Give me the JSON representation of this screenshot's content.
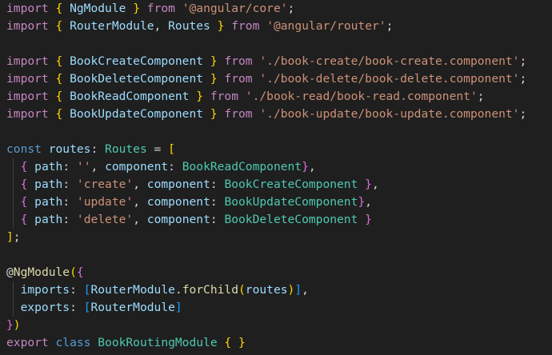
{
  "editor": {
    "background": "#1f1f1f",
    "lines": [
      [
        {
          "t": "import",
          "c": "control"
        },
        {
          "t": " ",
          "c": "punct"
        },
        {
          "t": "{",
          "c": "brace1"
        },
        {
          "t": " NgModule ",
          "c": "ident"
        },
        {
          "t": "}",
          "c": "brace1"
        },
        {
          "t": " ",
          "c": "punct"
        },
        {
          "t": "from",
          "c": "control"
        },
        {
          "t": " ",
          "c": "punct"
        },
        {
          "t": "'@angular/core'",
          "c": "string"
        },
        {
          "t": ";",
          "c": "punct"
        }
      ],
      [
        {
          "t": "import",
          "c": "control"
        },
        {
          "t": " ",
          "c": "punct"
        },
        {
          "t": "{",
          "c": "brace1"
        },
        {
          "t": " RouterModule",
          "c": "ident"
        },
        {
          "t": ", ",
          "c": "punct"
        },
        {
          "t": "Routes",
          "c": "ident"
        },
        {
          "t": " ",
          "c": "punct"
        },
        {
          "t": "}",
          "c": "brace1"
        },
        {
          "t": " ",
          "c": "punct"
        },
        {
          "t": "from",
          "c": "control"
        },
        {
          "t": " ",
          "c": "punct"
        },
        {
          "t": "'@angular/router'",
          "c": "string"
        },
        {
          "t": ";",
          "c": "punct"
        }
      ],
      [],
      [
        {
          "t": "import",
          "c": "control"
        },
        {
          "t": " ",
          "c": "punct"
        },
        {
          "t": "{",
          "c": "brace1"
        },
        {
          "t": " BookCreateComponent ",
          "c": "ident"
        },
        {
          "t": "}",
          "c": "brace1"
        },
        {
          "t": " ",
          "c": "punct"
        },
        {
          "t": "from",
          "c": "control"
        },
        {
          "t": " ",
          "c": "punct"
        },
        {
          "t": "'./book-create/book-create.component'",
          "c": "string"
        },
        {
          "t": ";",
          "c": "punct"
        }
      ],
      [
        {
          "t": "import",
          "c": "control"
        },
        {
          "t": " ",
          "c": "punct"
        },
        {
          "t": "{",
          "c": "brace1"
        },
        {
          "t": " BookDeleteComponent ",
          "c": "ident"
        },
        {
          "t": "}",
          "c": "brace1"
        },
        {
          "t": " ",
          "c": "punct"
        },
        {
          "t": "from",
          "c": "control"
        },
        {
          "t": " ",
          "c": "punct"
        },
        {
          "t": "'./book-delete/book-delete.component'",
          "c": "string"
        },
        {
          "t": ";",
          "c": "punct"
        }
      ],
      [
        {
          "t": "import",
          "c": "control"
        },
        {
          "t": " ",
          "c": "punct"
        },
        {
          "t": "{",
          "c": "brace1"
        },
        {
          "t": " BookReadComponent ",
          "c": "ident"
        },
        {
          "t": "}",
          "c": "brace1"
        },
        {
          "t": " ",
          "c": "punct"
        },
        {
          "t": "from",
          "c": "control"
        },
        {
          "t": " ",
          "c": "punct"
        },
        {
          "t": "'./book-read/book-read.component'",
          "c": "string"
        },
        {
          "t": ";",
          "c": "punct"
        }
      ],
      [
        {
          "t": "import",
          "c": "control"
        },
        {
          "t": " ",
          "c": "punct"
        },
        {
          "t": "{",
          "c": "brace1"
        },
        {
          "t": " BookUpdateComponent ",
          "c": "ident"
        },
        {
          "t": "}",
          "c": "brace1"
        },
        {
          "t": " ",
          "c": "punct"
        },
        {
          "t": "from",
          "c": "control"
        },
        {
          "t": " ",
          "c": "punct"
        },
        {
          "t": "'./book-update/book-update.component'",
          "c": "string"
        },
        {
          "t": ";",
          "c": "punct"
        }
      ],
      [],
      [
        {
          "t": "const",
          "c": "keyword"
        },
        {
          "t": " ",
          "c": "punct"
        },
        {
          "t": "routes",
          "c": "ident"
        },
        {
          "t": ": ",
          "c": "punct"
        },
        {
          "t": "Routes",
          "c": "type"
        },
        {
          "t": " = ",
          "c": "punct"
        },
        {
          "t": "[",
          "c": "brace1"
        }
      ],
      [
        {
          "t": "  ",
          "c": "punct"
        },
        {
          "t": "{",
          "c": "brace2"
        },
        {
          "t": " ",
          "c": "punct"
        },
        {
          "t": "path",
          "c": "ident"
        },
        {
          "t": ": ",
          "c": "punct"
        },
        {
          "t": "''",
          "c": "string"
        },
        {
          "t": ", ",
          "c": "punct"
        },
        {
          "t": "component",
          "c": "ident"
        },
        {
          "t": ": ",
          "c": "punct"
        },
        {
          "t": "BookReadComponent",
          "c": "type"
        },
        {
          "t": "}",
          "c": "brace2"
        },
        {
          "t": ",",
          "c": "punct"
        }
      ],
      [
        {
          "t": "  ",
          "c": "punct"
        },
        {
          "t": "{",
          "c": "brace2"
        },
        {
          "t": " ",
          "c": "punct"
        },
        {
          "t": "path",
          "c": "ident"
        },
        {
          "t": ": ",
          "c": "punct"
        },
        {
          "t": "'create'",
          "c": "string"
        },
        {
          "t": ", ",
          "c": "punct"
        },
        {
          "t": "component",
          "c": "ident"
        },
        {
          "t": ": ",
          "c": "punct"
        },
        {
          "t": "BookCreateComponent",
          "c": "type"
        },
        {
          "t": " ",
          "c": "punct"
        },
        {
          "t": "}",
          "c": "brace2"
        },
        {
          "t": ",",
          "c": "punct"
        }
      ],
      [
        {
          "t": "  ",
          "c": "punct"
        },
        {
          "t": "{",
          "c": "brace2"
        },
        {
          "t": " ",
          "c": "punct"
        },
        {
          "t": "path",
          "c": "ident"
        },
        {
          "t": ": ",
          "c": "punct"
        },
        {
          "t": "'update'",
          "c": "string"
        },
        {
          "t": ", ",
          "c": "punct"
        },
        {
          "t": "component",
          "c": "ident"
        },
        {
          "t": ": ",
          "c": "punct"
        },
        {
          "t": "BookUpdateComponent",
          "c": "type"
        },
        {
          "t": "}",
          "c": "brace2"
        },
        {
          "t": ",",
          "c": "punct"
        }
      ],
      [
        {
          "t": "  ",
          "c": "punct"
        },
        {
          "t": "{",
          "c": "brace2"
        },
        {
          "t": " ",
          "c": "punct"
        },
        {
          "t": "path",
          "c": "ident"
        },
        {
          "t": ": ",
          "c": "punct"
        },
        {
          "t": "'delete'",
          "c": "string"
        },
        {
          "t": ", ",
          "c": "punct"
        },
        {
          "t": "component",
          "c": "ident"
        },
        {
          "t": ": ",
          "c": "punct"
        },
        {
          "t": "BookDeleteComponent",
          "c": "type"
        },
        {
          "t": " ",
          "c": "punct"
        },
        {
          "t": "}",
          "c": "brace2"
        }
      ],
      [
        {
          "t": "]",
          "c": "brace1"
        },
        {
          "t": ";",
          "c": "punct"
        }
      ],
      [],
      [
        {
          "t": "@",
          "c": "punct"
        },
        {
          "t": "NgModule",
          "c": "decorator"
        },
        {
          "t": "(",
          "c": "brace1"
        },
        {
          "t": "{",
          "c": "brace2"
        }
      ],
      [
        {
          "t": "  ",
          "c": "punct"
        },
        {
          "t": "imports",
          "c": "ident"
        },
        {
          "t": ": ",
          "c": "punct"
        },
        {
          "t": "[",
          "c": "brace3"
        },
        {
          "t": "RouterModule",
          "c": "ident"
        },
        {
          "t": ".",
          "c": "punct"
        },
        {
          "t": "forChild",
          "c": "func"
        },
        {
          "t": "(",
          "c": "brace1"
        },
        {
          "t": "routes",
          "c": "ident"
        },
        {
          "t": ")",
          "c": "brace1"
        },
        {
          "t": "]",
          "c": "brace3"
        },
        {
          "t": ",",
          "c": "punct"
        }
      ],
      [
        {
          "t": "  ",
          "c": "punct"
        },
        {
          "t": "exports",
          "c": "ident"
        },
        {
          "t": ": ",
          "c": "punct"
        },
        {
          "t": "[",
          "c": "brace3"
        },
        {
          "t": "RouterModule",
          "c": "ident"
        },
        {
          "t": "]",
          "c": "brace3"
        }
      ],
      [
        {
          "t": "}",
          "c": "brace2"
        },
        {
          "t": ")",
          "c": "brace1"
        }
      ],
      [
        {
          "t": "export",
          "c": "control"
        },
        {
          "t": " ",
          "c": "punct"
        },
        {
          "t": "class",
          "c": "keyword"
        },
        {
          "t": " ",
          "c": "punct"
        },
        {
          "t": "BookRoutingModule",
          "c": "type"
        },
        {
          "t": " ",
          "c": "punct"
        },
        {
          "t": "{",
          "c": "brace1"
        },
        {
          "t": " ",
          "c": "punct"
        },
        {
          "t": "}",
          "c": "brace1"
        }
      ]
    ],
    "indented_lines": [
      9,
      10,
      11,
      12,
      16,
      17
    ]
  }
}
